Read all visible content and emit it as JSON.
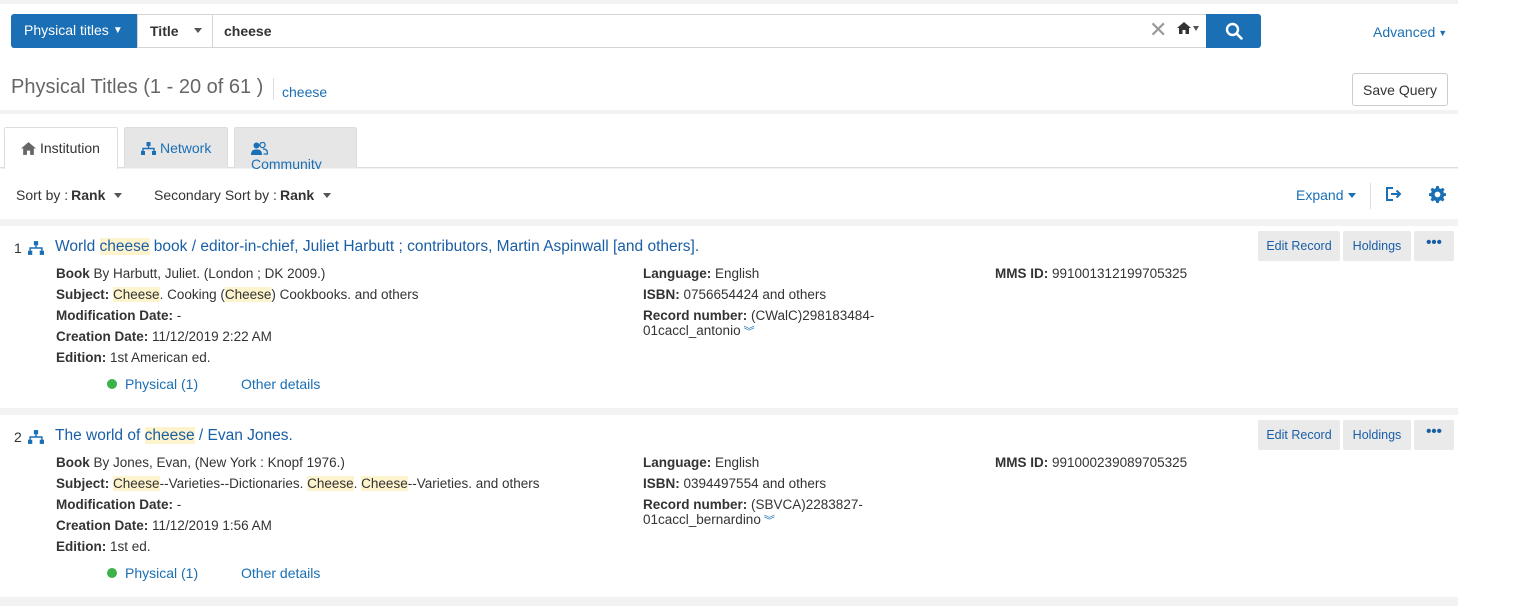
{
  "search": {
    "scope_label": "Physical titles",
    "field_label": "Title",
    "query": "cheese",
    "advanced_label": "Advanced"
  },
  "results": {
    "title": "Physical Titles (1 - 20 of 61 )",
    "query_link": "cheese",
    "save_query_label": "Save Query"
  },
  "tabs": [
    {
      "label": "Institution",
      "icon": "home-icon",
      "active": true
    },
    {
      "label": "Network",
      "icon": "network-icon",
      "active": false
    },
    {
      "label": "Community",
      "icon": "users-icon",
      "active": false
    }
  ],
  "sort": {
    "primary_label": "Sort by :",
    "primary_value": "Rank",
    "secondary_label": "Secondary Sort by :",
    "secondary_value": "Rank",
    "expand_label": "Expand"
  },
  "labels": {
    "language": "Language:",
    "isbn": "ISBN:",
    "record_number": "Record number:",
    "mms_id": "MMS ID:",
    "subject": "Subject:",
    "modification_date": "Modification Date:",
    "creation_date": "Creation Date:",
    "edition": "Edition:",
    "edit_record": "Edit Record",
    "holdings": "Holdings",
    "more": "•••",
    "other_details": "Other details"
  },
  "records": [
    {
      "number": "1",
      "title_pre": "World ",
      "title_hl": "cheese",
      "title_post": " book / editor-in-chief, Juliet Harbutt ; contributors, Martin Aspinwall [and others].",
      "type": "Book",
      "author": " By Harbutt, Juliet. (London ; DK 2009.)",
      "subject_parts": [
        {
          "t": "Cheese",
          "hl": true
        },
        {
          "t": ". Cooking (",
          "hl": false
        },
        {
          "t": "Cheese",
          "hl": true
        },
        {
          "t": ") Cookbooks. and others",
          "hl": false
        }
      ],
      "modification_date": " -",
      "creation_date": " 11/12/2019 2:22 AM",
      "edition": " 1st American ed.",
      "language": " English",
      "isbn": " 0756654424 and others",
      "record_number_1": " (CWalC)298183484-",
      "record_number_2": "01caccl_antonio",
      "mms_id": " 991001312199705325",
      "physical": "Physical (1)"
    },
    {
      "number": "2",
      "title_pre": "The world of ",
      "title_hl": "cheese",
      "title_post": " / Evan Jones.",
      "type": "Book",
      "author": " By Jones, Evan, (New York : Knopf 1976.)",
      "subject_parts": [
        {
          "t": "Cheese",
          "hl": true
        },
        {
          "t": "--Varieties--Dictionaries. ",
          "hl": false
        },
        {
          "t": "Cheese",
          "hl": true
        },
        {
          "t": ". ",
          "hl": false
        },
        {
          "t": "Cheese",
          "hl": true
        },
        {
          "t": "--Varieties. and others",
          "hl": false
        }
      ],
      "modification_date": " -",
      "creation_date": " 11/12/2019 1:56 AM",
      "edition": " 1st ed.",
      "language": " English",
      "isbn": " 0394497554 and others",
      "record_number_1": " (SBVCA)2283827-",
      "record_number_2": "01caccl_bernardino",
      "mms_id": " 991000239089705325",
      "physical": "Physical (1)"
    }
  ],
  "colors": {
    "primary": "#1a6fb5",
    "link": "#1a5ea5",
    "highlight": "#fdf3cc",
    "available": "#3cb34a"
  }
}
